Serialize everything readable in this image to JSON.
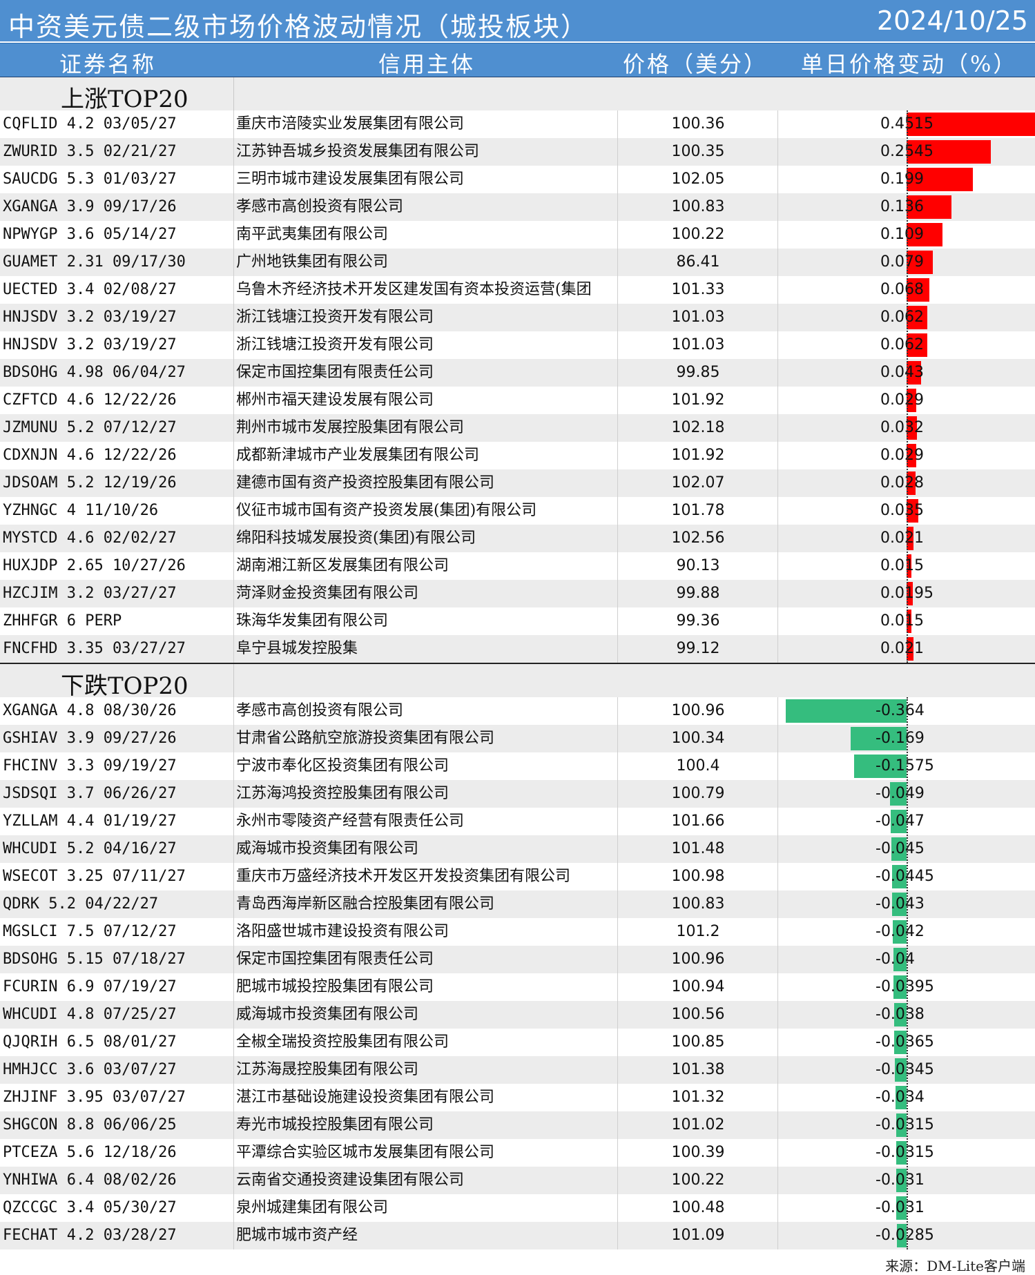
{
  "title": "中资美元债二级市场价格波动情况（城投板块）",
  "date": "2024/10/25",
  "headers": {
    "col1": "证券名称",
    "col2": "信用主体",
    "col3": "价格（美分）",
    "col4": "单日价格变动（%）"
  },
  "up_label": "上涨TOP20",
  "down_label": "下跌TOP20",
  "colors": {
    "header_bg": "#4f8fd0",
    "up_bar": "#ff0000",
    "down_bar": "#35bd7e",
    "stripe": "#ececec"
  },
  "chart_data": {
    "type": "bar",
    "up": [
      {
        "name": "CQFLID 4.2 03/05/27",
        "issuer": "重庆市涪陵实业发展集团有限公司",
        "price": "100.36",
        "change": "0.4515"
      },
      {
        "name": "ZWURID 3.5 02/21/27",
        "issuer": "江苏钟吾城乡投资发展集团有限公司",
        "price": "100.35",
        "change": "0.2545"
      },
      {
        "name": "SAUCDG 5.3 01/03/27",
        "issuer": "三明市城市建设发展集团有限公司",
        "price": "102.05",
        "change": "0.199"
      },
      {
        "name": "XGANGA 3.9 09/17/26",
        "issuer": "孝感市高创投资有限公司",
        "price": "100.83",
        "change": "0.136"
      },
      {
        "name": "NPWYGP 3.6 05/14/27",
        "issuer": "南平武夷集团有限公司",
        "price": "100.22",
        "change": "0.109"
      },
      {
        "name": "GUAMET 2.31 09/17/30",
        "issuer": "广州地铁集团有限公司",
        "price": "86.41",
        "change": "0.079"
      },
      {
        "name": "UECTED 3.4 02/08/27",
        "issuer": "乌鲁木齐经济技术开发区建发国有资本投资运营(集团",
        "price": "101.33",
        "change": "0.068"
      },
      {
        "name": "HNJSDV 3.2 03/19/27",
        "issuer": "浙江钱塘江投资开发有限公司",
        "price": "101.03",
        "change": "0.062"
      },
      {
        "name": "HNJSDV 3.2 03/19/27",
        "issuer": "浙江钱塘江投资开发有限公司",
        "price": "101.03",
        "change": "0.062"
      },
      {
        "name": "BDSOHG 4.98 06/04/27",
        "issuer": "保定市国控集团有限责任公司",
        "price": "99.85",
        "change": "0.043"
      },
      {
        "name": "CZFTCD 4.6 12/22/26",
        "issuer": "郴州市福天建设发展有限公司",
        "price": "101.92",
        "change": "0.029"
      },
      {
        "name": "JZMUNU 5.2 07/12/27",
        "issuer": "荆州市城市发展控股集团有限公司",
        "price": "102.18",
        "change": "0.032"
      },
      {
        "name": "CDXNJN 4.6 12/22/26",
        "issuer": "成都新津城市产业发展集团有限公司",
        "price": "101.92",
        "change": "0.029"
      },
      {
        "name": "JDSOAM 5.2 12/19/26",
        "issuer": "建德市国有资产投资控股集团有限公司",
        "price": "102.07",
        "change": "0.028"
      },
      {
        "name": "YZHNGC 4 11/10/26",
        "issuer": "仪征市城市国有资产投资发展(集团)有限公司",
        "price": "101.78",
        "change": "0.035"
      },
      {
        "name": "MYSTCD 4.6 02/02/27",
        "issuer": "绵阳科技城发展投资(集团)有限公司",
        "price": "102.56",
        "change": "0.021"
      },
      {
        "name": "HUXJDP 2.65 10/27/26",
        "issuer": "湖南湘江新区发展集团有限公司",
        "price": "90.13",
        "change": "0.015"
      },
      {
        "name": "HZCJIM 3.2 03/27/27",
        "issuer": "菏泽财金投资集团有限公司",
        "price": "99.88",
        "change": "0.0195"
      },
      {
        "name": "ZHHFGR 6 PERP",
        "issuer": "珠海华发集团有限公司",
        "price": "99.36",
        "change": "0.015"
      },
      {
        "name": "FNCFHD 3.35 03/27/27",
        "issuer": "阜宁县城发控股集",
        "price": "99.12",
        "change": "0.021"
      }
    ],
    "down": [
      {
        "name": "XGANGA 4.8 08/30/26",
        "issuer": "孝感市高创投资有限公司",
        "price": "100.96",
        "change": "-0.364"
      },
      {
        "name": "GSHIAV 3.9 09/27/26",
        "issuer": "甘肃省公路航空旅游投资集团有限公司",
        "price": "100.34",
        "change": "-0.169"
      },
      {
        "name": "FHCINV 3.3 09/19/27",
        "issuer": "宁波市奉化区投资集团有限公司",
        "price": "100.4",
        "change": "-0.1575"
      },
      {
        "name": "JSDSQI 3.7 06/26/27",
        "issuer": "江苏海鸿投资控股集团有限公司",
        "price": "100.79",
        "change": "-0.049"
      },
      {
        "name": "YZLLAM 4.4 01/19/27",
        "issuer": "永州市零陵资产经营有限责任公司",
        "price": "101.66",
        "change": "-0.047"
      },
      {
        "name": "WHCUDI 5.2 04/16/27",
        "issuer": "威海城市投资集团有限公司",
        "price": "101.48",
        "change": "-0.045"
      },
      {
        "name": "WSECOT 3.25 07/11/27",
        "issuer": "重庆市万盛经济技术开发区开发投资集团有限公司",
        "price": "100.98",
        "change": "-0.0445"
      },
      {
        "name": "QDRK 5.2 04/22/27",
        "issuer": "青岛西海岸新区融合控股集团有限公司",
        "price": "100.83",
        "change": "-0.043"
      },
      {
        "name": "MGSLCI 7.5 07/12/27",
        "issuer": "洛阳盛世城市建设投资有限公司",
        "price": "101.2",
        "change": "-0.042"
      },
      {
        "name": "BDSOHG 5.15 07/18/27",
        "issuer": "保定市国控集团有限责任公司",
        "price": "100.96",
        "change": "-0.04"
      },
      {
        "name": "FCURIN 6.9 07/19/27",
        "issuer": "肥城市城投控股集团有限公司",
        "price": "100.94",
        "change": "-0.0395"
      },
      {
        "name": "WHCUDI 4.8 07/25/27",
        "issuer": "威海城市投资集团有限公司",
        "price": "100.56",
        "change": "-0.038"
      },
      {
        "name": "QJQRIH 6.5 08/01/27",
        "issuer": "全椒全瑞投资控股集团有限公司",
        "price": "100.85",
        "change": "-0.0365"
      },
      {
        "name": "HMHJCC 3.6 03/07/27",
        "issuer": "江苏海晟控股集团有限公司",
        "price": "101.38",
        "change": "-0.0345"
      },
      {
        "name": "ZHJINF 3.95 03/07/27",
        "issuer": "湛江市基础设施建设投资集团有限公司",
        "price": "101.32",
        "change": "-0.034"
      },
      {
        "name": "SHGCON 8.8 06/06/25",
        "issuer": "寿光市城投控股集团有限公司",
        "price": "101.02",
        "change": "-0.0315"
      },
      {
        "name": "PTCEZA 5.6 12/18/26",
        "issuer": "平潭综合实验区城市发展集团有限公司",
        "price": "100.39",
        "change": "-0.0315"
      },
      {
        "name": "YNHIWA 6.4 08/02/26",
        "issuer": "云南省交通投资建设集团有限公司",
        "price": "100.22",
        "change": "-0.031"
      },
      {
        "name": "QZCCGC 3.4 05/30/27",
        "issuer": "泉州城建集团有限公司",
        "price": "100.48",
        "change": "-0.031"
      },
      {
        "name": "FECHAT 4.2 03/28/27",
        "issuer": "肥城市城市资产经",
        "price": "101.09",
        "change": "-0.0285"
      }
    ]
  },
  "footer": {
    "source": "来源：DM-Lite客户端"
  }
}
